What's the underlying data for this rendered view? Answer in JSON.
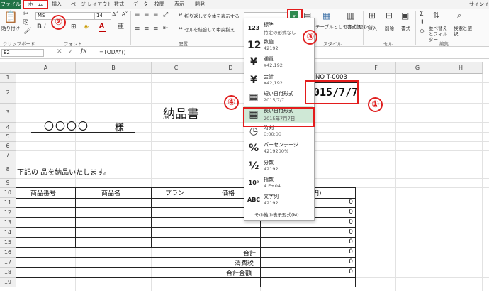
{
  "ribbon_tabs": [
    "ファイル",
    "ホーム",
    "挿入",
    "ページ レイアウト",
    "数式",
    "データ",
    "校閲",
    "表示",
    "開発"
  ],
  "signin": "サインイン",
  "ribbon": {
    "paste": "貼り付け",
    "clipboard": "クリップボード",
    "font_name": "MS",
    "font_size": "14",
    "font_group": "フォント",
    "wrap_text": "折り返して全体を表示する",
    "merge_center": "セルを結合して中央揃え",
    "alignment_group": "配置",
    "table_format": "テーブルとして書式設定",
    "cell_style": "セルのスタイル",
    "style_group": "スタイル",
    "insert": "挿入",
    "delete": "削除",
    "format": "書式",
    "cells_group": "セル",
    "sort_filter": "並べ替えとフィルター",
    "find_select": "検索と選択",
    "edit_group": "編集"
  },
  "formula_bar": {
    "name_box": "E2",
    "fx": "fx",
    "formula": "=TODAY()"
  },
  "columns": [
    "A",
    "B",
    "C",
    "D",
    "E",
    "F",
    "G",
    "H"
  ],
  "rows": [
    "1",
    "2",
    "3",
    "4",
    "5",
    "6",
    "7",
    "8",
    "9",
    "10",
    "11",
    "12",
    "13",
    "14",
    "15",
    "16",
    "17",
    "18",
    "19"
  ],
  "sheet": {
    "no_label": "NO T-0003",
    "date_value": "015/7/7",
    "title": "納品書",
    "customer": "〇〇〇〇",
    "sama": "様",
    "message": "下記の 品を納品いたします。",
    "headers": [
      "商品番号",
      "商品名",
      "プラン",
      "価格",
      "円)"
    ],
    "zeros": [
      "0",
      "0",
      "0",
      "0",
      "0",
      "0",
      "0",
      "0"
    ],
    "subtotal": "合計",
    "tax": "消費税",
    "grand_total": "合計金額"
  },
  "format_dropdown": {
    "items": [
      {
        "icon": "123",
        "name": "標準",
        "value": "特定の形式なし"
      },
      {
        "icon": "12",
        "name": "数値",
        "value": "42192"
      },
      {
        "icon": "¥",
        "name": "通貨",
        "value": "¥42,192"
      },
      {
        "icon": "¥",
        "name": "会計",
        "value": " ¥42,192"
      },
      {
        "icon": "▦",
        "name": "短い日付形式",
        "value": "2015/7/7"
      },
      {
        "icon": "▦",
        "name": "長い日付形式",
        "value": "2015年7月7日"
      },
      {
        "icon": "◷",
        "name": "時刻",
        "value": "0:00:00"
      },
      {
        "icon": "%",
        "name": "パーセンテージ",
        "value": "4219200%"
      },
      {
        "icon": "½",
        "name": "分数",
        "value": "42192"
      },
      {
        "icon": "10²",
        "name": "指数",
        "value": "4.E+04"
      },
      {
        "icon": "ABC",
        "name": "文字列",
        "value": "42192"
      }
    ],
    "more": "その他の表示形式(M)..."
  },
  "callouts": [
    "①",
    "②",
    "③",
    "④"
  ],
  "colors": {
    "excel_green": "#217346",
    "callout_red": "#e02020",
    "highlight_green": "#cfe8d6"
  }
}
